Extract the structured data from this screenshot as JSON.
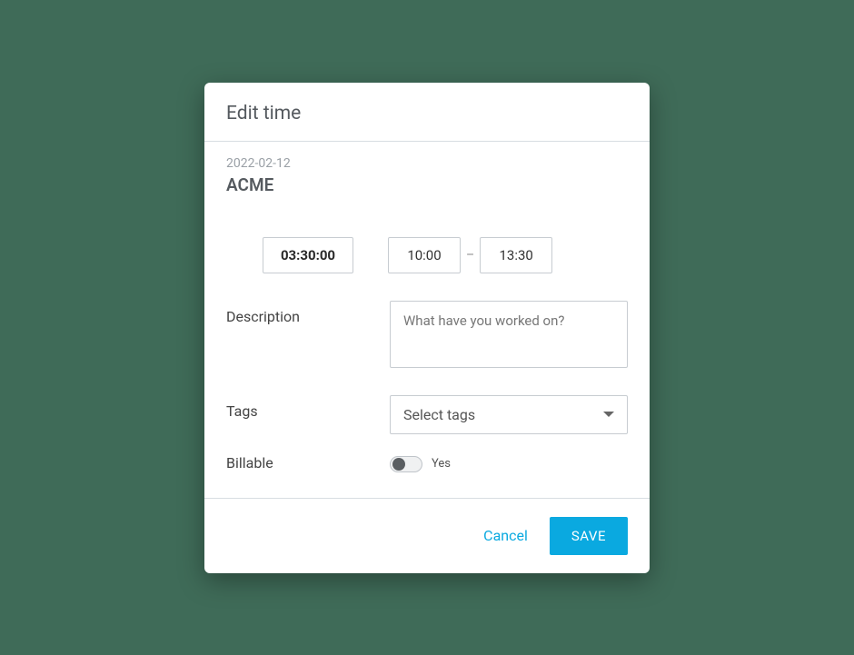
{
  "dialog": {
    "title": "Edit time",
    "entry": {
      "date": "2022-02-12",
      "project": "ACME",
      "duration": "03:30:00",
      "start_time": "10:00",
      "end_time": "13:30"
    },
    "description": {
      "label": "Description",
      "placeholder": "What have you worked on?",
      "value": ""
    },
    "tags": {
      "label": "Tags",
      "placeholder": "Select tags"
    },
    "billable": {
      "label": "Billable",
      "value_label": "Yes",
      "on": false
    },
    "actions": {
      "cancel": "Cancel",
      "save": "SAVE"
    }
  }
}
